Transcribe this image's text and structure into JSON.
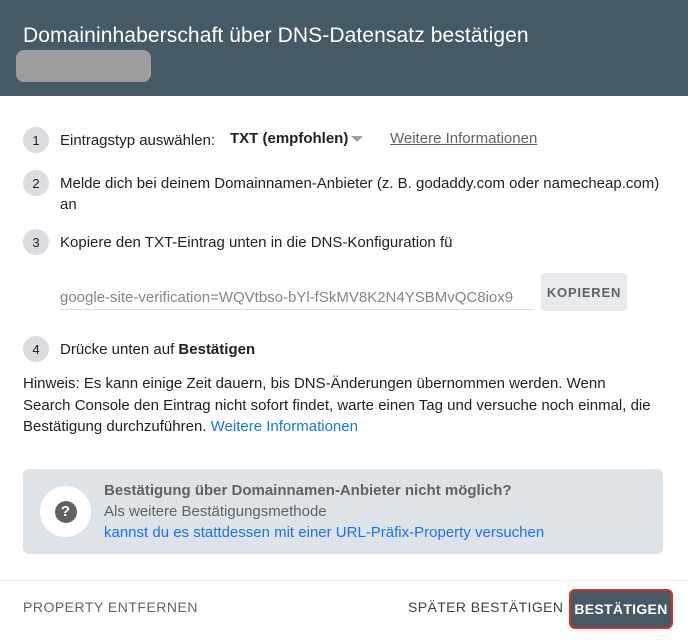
{
  "header": {
    "title": "Domaininhaberschaft über DNS-Datensatz bestätigen"
  },
  "steps": {
    "s1": {
      "number": "1",
      "label": "Eintragstyp auswählen:",
      "record_type": "TXT (empfohlen)",
      "more_link": "Weitere Informationen"
    },
    "s2": {
      "number": "2",
      "text": "Melde dich bei deinem Domainnamen-Anbieter (z. B. godaddy.com oder namecheap.com) an"
    },
    "s3": {
      "number": "3",
      "text": "Kopiere den TXT-Eintrag unten in die DNS-Konfiguration für",
      "record_value": "google-site-verification=WQVtbso-bYl-fSkMV8K2N4YSBMvQC8iox9",
      "copy_label": "KOPIEREN"
    },
    "s4": {
      "number": "4",
      "text_prefix": "Drücke unten auf",
      "text_bold": "Bestätigen"
    }
  },
  "hint": {
    "text": "Hinweis: Es kann einige Zeit dauern, bis DNS-Änderungen übernommen werden. Wenn Search Console den Eintrag nicht sofort findet, warte einen Tag und versuche noch einmal, die Bestätigung durchzuführen.",
    "link": "Weitere Informationen"
  },
  "info_box": {
    "icon": "help-icon",
    "title": "Bestätigung über Domainnamen-Anbieter nicht möglich?",
    "line": "Als weitere Bestätigungsmethode",
    "link": "kannst du es stattdessen mit einer URL-Präfix-Property versuchen"
  },
  "footer": {
    "remove_label": "PROPERTY ENTFERNEN",
    "later_label": "SPÄTER BESTÄTIGEN",
    "confirm_label": "BESTÄTIGEN"
  },
  "colors": {
    "header_bg": "#455a64",
    "link": "#1a73e8",
    "confirm_highlight": "#d93025"
  }
}
